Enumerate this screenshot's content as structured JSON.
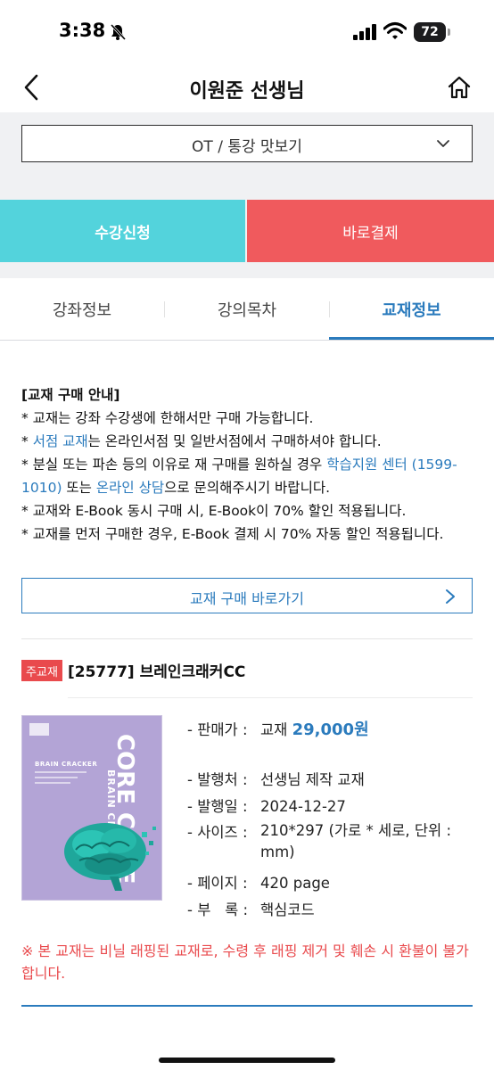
{
  "status": {
    "time": "3:38",
    "battery": "72"
  },
  "nav": {
    "title": "이원준 선생님"
  },
  "select": {
    "value": "OT / 통강 맛보기"
  },
  "actions": {
    "enroll_label": "수강신청",
    "buy_label": "바로결제"
  },
  "tabs": [
    {
      "label": "강좌정보",
      "active": false
    },
    {
      "label": "강의목차",
      "active": false
    },
    {
      "label": "교재정보",
      "active": true
    }
  ],
  "notice": {
    "title": "[교재 구매 안내]",
    "line1": "* 교재는 강좌 수강생에 한해서만 구매 가능합니다.",
    "line2_prefix": "* ",
    "line2_link": "서점 교재",
    "line2_suffix": "는 온라인서점 및 일반서점에서 구매하셔야 합니다.",
    "line3_prefix": "* 분실 또는 파손 등의 이유로 재 구매를 원하실 경우 ",
    "line3_link1": "학습지원 센터 (1599-1010)",
    "line3_middle": " 또는 ",
    "line3_link2": "온라인 상담",
    "line3_suffix": "으로 문의해주시기 바랍니다.",
    "line4": "* 교재와 E-Book 동시 구매 시, E-Book이 70% 할인 적용됩니다.",
    "line5": "* 교재를 먼저 구매한 경우, E-Book 결제 시 70% 자동 할인 적용됩니다."
  },
  "purchase_link": {
    "label": "교재 구매 바로가기"
  },
  "book": {
    "badge": "주교재",
    "title": "[25777] 브레인크래커CC",
    "cover_brand": "BRAIN CRACKER",
    "cover_title": "CORE CODE",
    "cover_subtitle": "BRAIN CRACKER",
    "rows": [
      {
        "label": "- 판매가 :",
        "prefix": "교재 ",
        "value": "29,000원"
      },
      {
        "label": "- 발행처 :",
        "value": "선생님 제작 교재"
      },
      {
        "label": "- 발행일 :",
        "value": "2024-12-27"
      },
      {
        "label": "- 사이즈 :",
        "value": "210*297 (가로 * 세로, 단위 : mm)"
      },
      {
        "label": "- 페이지 :",
        "value": "420 page"
      },
      {
        "label": "- 부   록 :",
        "value": "핵심코드"
      }
    ]
  },
  "warning": {
    "text": "※ 본 교재는 비닐 래핑된 교재로, 수령 후 래핑 제거 및 훼손 시 환불이 불가합니다."
  },
  "colors": {
    "accent_blue": "#2b7bbd",
    "enroll_cyan": "#53d3dc",
    "buy_red": "#f05a5d",
    "warning_red": "#e94a4d"
  }
}
